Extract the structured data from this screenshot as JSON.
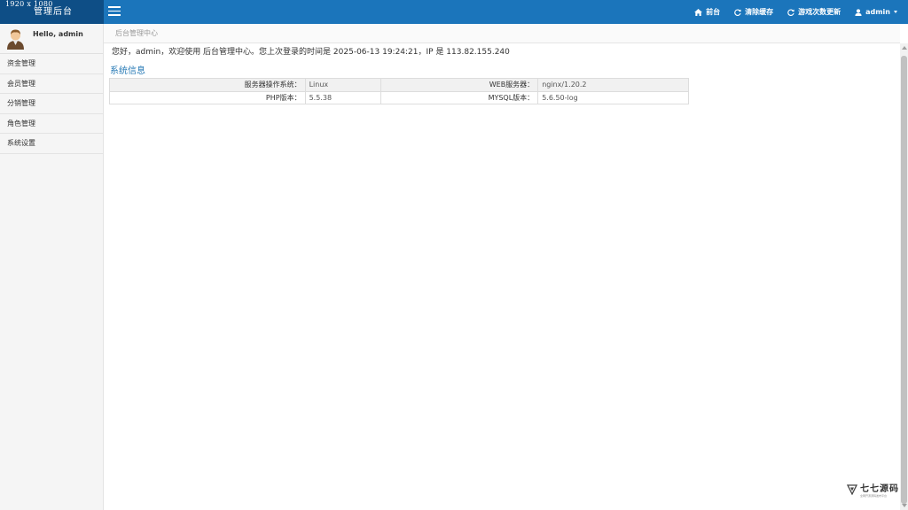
{
  "brand": {
    "resolution": "1920 x 1080",
    "name": "管理后台"
  },
  "topnav": {
    "home_label": "前台",
    "clear_cache_label": "清除缓存",
    "game_update_label": "游戏次数更新",
    "user_label": "admin"
  },
  "sidebar": {
    "hello": "Hello, admin",
    "items": [
      {
        "label": "资金管理"
      },
      {
        "label": "会员管理"
      },
      {
        "label": "分销管理"
      },
      {
        "label": "角色管理"
      },
      {
        "label": "系统设置"
      }
    ]
  },
  "main": {
    "breadcrumb": "后台管理中心",
    "welcome": "您好，admin，欢迎使用 后台管理中心。您上次登录的时间是 2025-06-13 19:24:21，IP 是 113.82.155.240",
    "section_title": "系统信息",
    "info_rows": [
      {
        "label1": "服务器操作系统：",
        "value1": "Linux",
        "label2": "WEB服务器：",
        "value2": "nginx/1.20.2"
      },
      {
        "label1": "PHP版本：",
        "value1": "5.5.38",
        "label2": "MYSQL版本：",
        "value2": "5.6.50-log"
      }
    ]
  },
  "watermark": {
    "main": "七七源码",
    "sub": "全网开源源码发布平台"
  },
  "colors": {
    "topbar": "#1B75BB",
    "brand_bg": "#0E4E86",
    "accent_text": "#2679B5"
  },
  "icons": [
    "menu-icon",
    "home-icon",
    "refresh-icon",
    "user-icon",
    "caret-down-icon"
  ]
}
